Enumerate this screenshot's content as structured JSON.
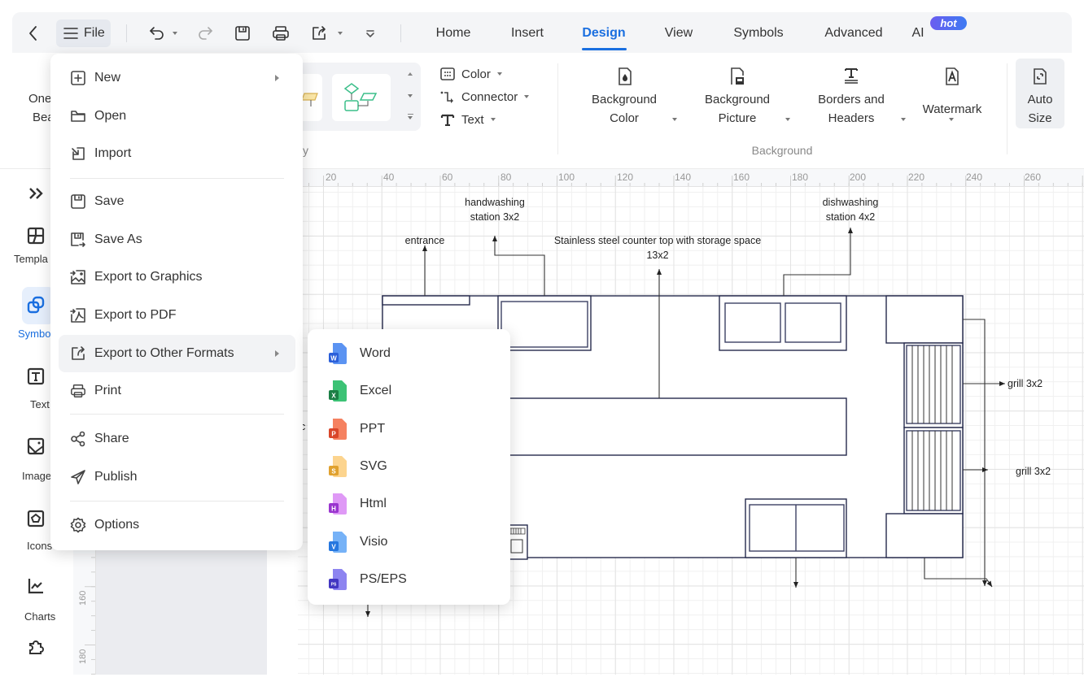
{
  "quick_toolbar": {
    "file_label": "File",
    "icons": [
      "back-icon",
      "hamburger-icon",
      "undo-icon",
      "redo-icon",
      "save-icon",
      "print-icon",
      "export-icon",
      "more-icon"
    ]
  },
  "tabs": [
    {
      "label": "Home"
    },
    {
      "label": "Insert"
    },
    {
      "label": "Design",
      "active": true
    },
    {
      "label": "View"
    },
    {
      "label": "Symbols"
    },
    {
      "label": "Advanced"
    },
    {
      "label": "AI",
      "badge": "hot"
    }
  ],
  "ribbon": {
    "clipped_button": {
      "line1": "One",
      "line2": "Bea"
    },
    "clipped_group_label": "y",
    "format": {
      "color": "Color",
      "connector": "Connector",
      "text": "Text"
    },
    "background_group": {
      "label": "Background",
      "buttons": [
        {
          "line1": "Background",
          "line2": "Color",
          "icon": "background-color-icon"
        },
        {
          "line1": "Background",
          "line2": "Picture",
          "icon": "background-picture-icon"
        },
        {
          "line1": "Borders and",
          "line2": "Headers",
          "icon": "borders-headers-icon"
        },
        {
          "line1": "Watermark",
          "icon": "watermark-icon"
        }
      ]
    },
    "auto_size": {
      "line1": "Auto",
      "line2": "Size"
    }
  },
  "sidebar": {
    "items": [
      {
        "icon": "expand-icon",
        "label": ""
      },
      {
        "icon": "templates-icon",
        "label": "Templa"
      },
      {
        "icon": "symbols-icon",
        "label": "Symbo",
        "active": true
      },
      {
        "icon": "text-icon",
        "label": "Text"
      },
      {
        "icon": "images-icon",
        "label": "Image"
      },
      {
        "icon": "icons-icon",
        "label": "Icons"
      },
      {
        "icon": "charts-icon",
        "label": "Charts"
      },
      {
        "icon": "plugin-icon",
        "label": ""
      }
    ]
  },
  "file_menu": {
    "items": [
      {
        "label": "New",
        "icon": "new-icon",
        "submenu": true
      },
      {
        "label": "Open",
        "icon": "folder-icon"
      },
      {
        "label": "Import",
        "icon": "import-icon"
      },
      {
        "label": "Save",
        "icon": "save-icon"
      },
      {
        "label": "Save As",
        "icon": "save-as-icon"
      },
      {
        "label": "Export to Graphics",
        "icon": "export-graphics-icon"
      },
      {
        "label": "Export to PDF",
        "icon": "export-pdf-icon"
      },
      {
        "label": "Export to Other Formats",
        "icon": "export-other-icon",
        "submenu": true,
        "highlighted": true
      },
      {
        "label": "Print",
        "icon": "print-icon"
      },
      {
        "label": "Share",
        "icon": "share-icon"
      },
      {
        "label": "Publish",
        "icon": "publish-icon"
      },
      {
        "label": "Options",
        "icon": "gear-icon"
      }
    ]
  },
  "export_submenu": {
    "items": [
      {
        "label": "Word",
        "badge": "W",
        "color": "#2b5fd9",
        "light": "#5b93f2"
      },
      {
        "label": "Excel",
        "badge": "X",
        "color": "#1b7f45",
        "light": "#3cc275"
      },
      {
        "label": "PPT",
        "badge": "P",
        "color": "#d9462a",
        "light": "#f58160"
      },
      {
        "label": "SVG",
        "badge": "S",
        "color": "#e0a12e",
        "light": "#fcd48e"
      },
      {
        "label": "Html",
        "badge": "H",
        "color": "#9a35cf",
        "light": "#df99f6"
      },
      {
        "label": "Visio",
        "badge": "V",
        "color": "#2677df",
        "light": "#76b2f7"
      },
      {
        "label": "PS/EPS",
        "badge": "PS",
        "color": "#4337c2",
        "light": "#8d84f0"
      }
    ]
  },
  "ruler": {
    "horizontal": [
      "20",
      "40",
      "60",
      "80",
      "100",
      "120",
      "140",
      "160",
      "180",
      "200",
      "220",
      "240",
      "260"
    ],
    "vertical": [
      "160",
      "180"
    ]
  },
  "diagram": {
    "labels": {
      "entrance": "entrance",
      "handwashing_1": "handwashing",
      "handwashing_2": "station 3x2",
      "counter_1": "Stainless steel counter top with storage space",
      "counter_2": "13x2",
      "dishwashing_1": "dishwashing",
      "dishwashing_2": "station 4x2",
      "grill_1": "grill 3x2",
      "grill_2": "grill 3x2",
      "clipped_fragment": "c"
    }
  },
  "colors": {
    "accent": "#1a6fe0",
    "diagram_stroke": "#262b4d",
    "hot_badge": "#6b5cf0"
  }
}
